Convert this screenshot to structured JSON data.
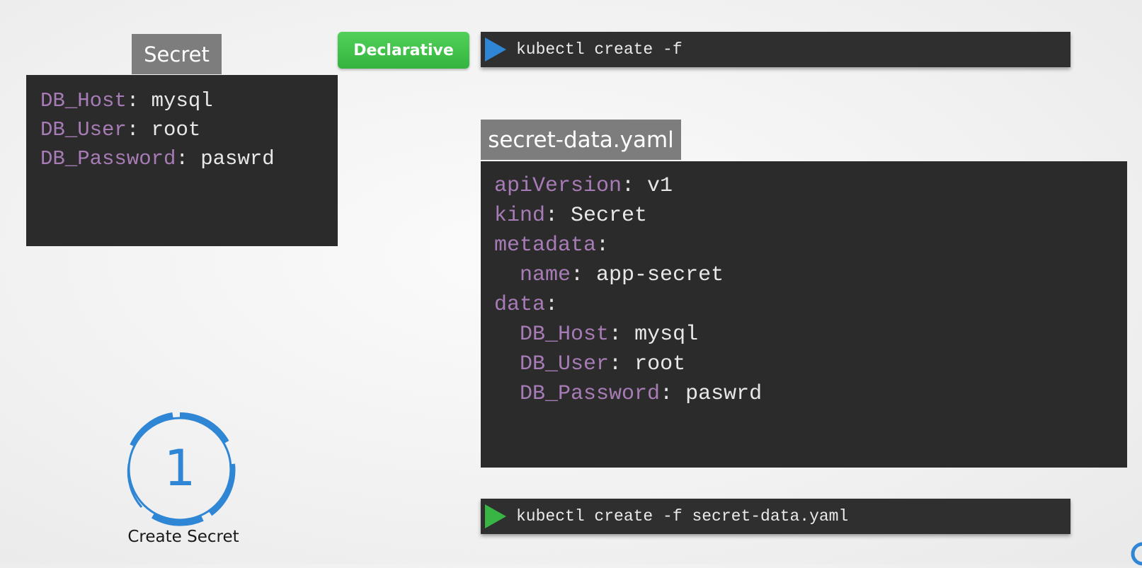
{
  "secret_box": {
    "title": "Secret",
    "lines": [
      {
        "key": "DB_Host",
        "sep": ": ",
        "value": "mysql"
      },
      {
        "key": "DB_User",
        "sep": ": ",
        "value": "root"
      },
      {
        "key": "DB_Password",
        "sep": ": ",
        "value": "paswrd"
      }
    ]
  },
  "declarative_badge": "Declarative",
  "commands": {
    "top": "kubectl create -f",
    "bottom": "kubectl create -f secret-data.yaml"
  },
  "yaml_file": {
    "filename": "secret-data.yaml",
    "lines": [
      {
        "indent": "",
        "key": "apiVersion",
        "sep": ": ",
        "value": "v1"
      },
      {
        "indent": "",
        "key": "kind",
        "sep": ": ",
        "value": "Secret"
      },
      {
        "indent": "",
        "key": "metadata",
        "sep": ":",
        "value": ""
      },
      {
        "indent": "  ",
        "key": "name",
        "sep": ": ",
        "value": "app-secret"
      },
      {
        "indent": "",
        "key": "data",
        "sep": ":",
        "value": ""
      },
      {
        "indent": "  ",
        "key": "DB_Host",
        "sep": ": ",
        "value": "mysql"
      },
      {
        "indent": "  ",
        "key": "DB_User",
        "sep": ": ",
        "value": "root"
      },
      {
        "indent": "  ",
        "key": "DB_Password",
        "sep": ": ",
        "value": "paswrd"
      }
    ]
  },
  "step": {
    "number": "1",
    "label": "Create Secret"
  },
  "colors": {
    "accent_blue": "#2f86d4",
    "accent_green": "#38b544",
    "key_purple": "#a77cb6",
    "panel_dark": "#2b2b2b"
  },
  "icons": {
    "top_play": "play-triangle-blue-icon",
    "bottom_play": "play-triangle-green-icon"
  }
}
